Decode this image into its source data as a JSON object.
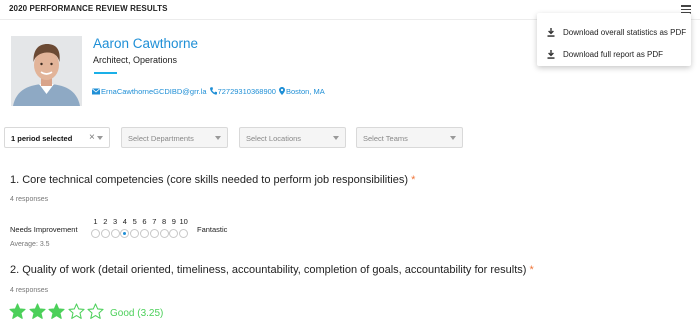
{
  "header": {
    "title": "2020 PERFORMANCE REVIEW RESULTS",
    "menu_icon": "hamburger-icon"
  },
  "menu": {
    "items": [
      {
        "label": "Download overall statistics as PDF",
        "icon": "download-icon"
      },
      {
        "label": "Download full report as PDF",
        "icon": "download-icon"
      }
    ]
  },
  "profile": {
    "name": "Aaron Cawthorne",
    "role": "Architect, Operations",
    "email": "ErnaCawthorneGCDIBD@grr.la",
    "phone": "72729310368900",
    "location": "Boston, MA",
    "accent_color": "#1ab0e8"
  },
  "filters": {
    "period": "1 period selected",
    "departments_placeholder": "Select Departments",
    "locations_placeholder": "Select Locations",
    "teams_placeholder": "Select Teams"
  },
  "questions": [
    {
      "title": "1. Core technical competencies (core skills needed to perform job responsibilities)",
      "required_mark": "*",
      "responses": "4 responses",
      "scale_low": "Needs Improvement",
      "scale_high": "Fantastic",
      "scale": [
        "1",
        "2",
        "3",
        "4",
        "5",
        "6",
        "7",
        "8",
        "9",
        "10"
      ],
      "selected_value": 4,
      "average": "Average: 3.5"
    },
    {
      "title": "2. Quality of work (detail oriented, timeliness, accountability, completion of goals, accountability for results)",
      "required_mark": "*",
      "responses": "4 responses",
      "stars_filled": 3,
      "stars_total": 5,
      "rating_label": "Good (3.25)",
      "star_color": "#4cd05a"
    }
  ],
  "colors": {
    "link": "#1f8fd6",
    "required": "#f0763a"
  }
}
